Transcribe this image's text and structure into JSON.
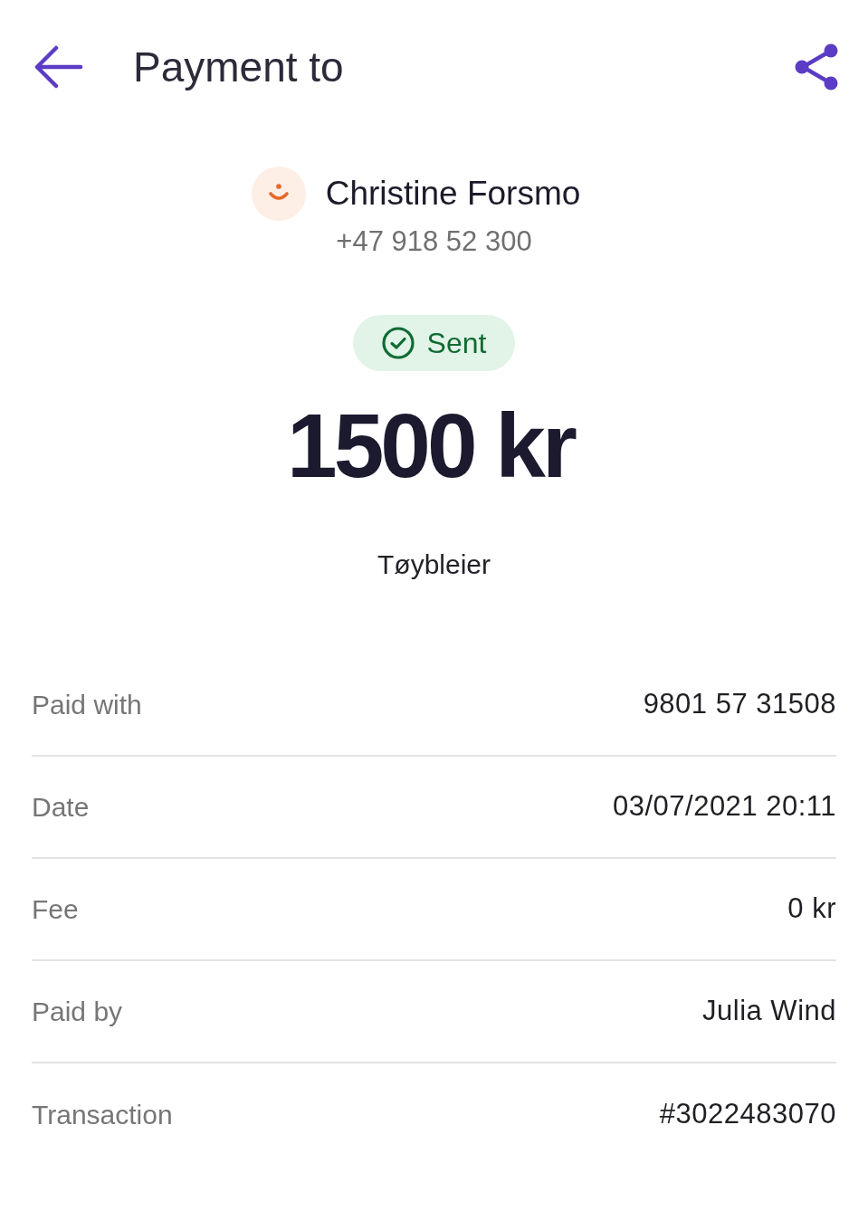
{
  "header": {
    "title": "Payment to"
  },
  "recipient": {
    "name": "Christine Forsmo",
    "phone": "+47 918 52 300"
  },
  "status": {
    "kind": "sent",
    "label": "Sent"
  },
  "amount": "1500 kr",
  "message": "Tøybleier",
  "details": [
    {
      "label": "Paid with",
      "value": "9801 57 31508"
    },
    {
      "label": "Date",
      "value": "03/07/2021 20:11"
    },
    {
      "label": "Fee",
      "value": "0 kr"
    },
    {
      "label": "Paid by",
      "value": "Julia Wind"
    },
    {
      "label": "Transaction",
      "value": "#3022483070"
    }
  ]
}
